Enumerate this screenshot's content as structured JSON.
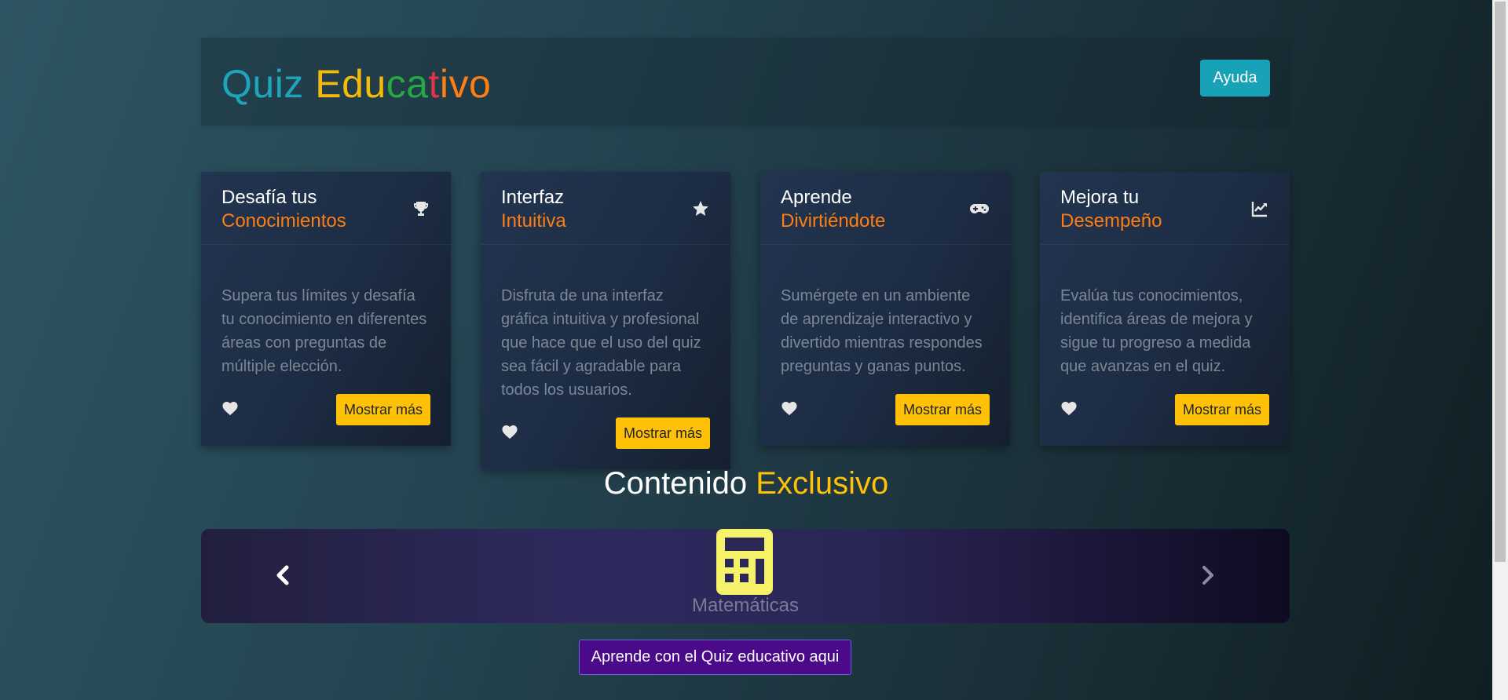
{
  "header": {
    "title_parts": [
      "Quiz",
      "Edu",
      "ca",
      "t",
      "ivo"
    ],
    "help_label": "Ayuda"
  },
  "cards": [
    {
      "title_line1": "Desafía tus",
      "title_line2": "Conocimientos",
      "icon": "trophy-icon",
      "text": "Supera tus límites y desafía tu conocimiento en diferentes áreas con preguntas de múltiple elección.",
      "button": "Mostrar más"
    },
    {
      "title_line1": "Interfaz",
      "title_line2": "Intuitiva",
      "icon": "star-icon",
      "text": "Disfruta de una interfaz gráfica intuitiva y profesional que hace que el uso del quiz sea fácil y agradable para todos los usuarios.",
      "button": "Mostrar más"
    },
    {
      "title_line1": "Aprende",
      "title_line2": "Divirtiéndote",
      "icon": "gamepad-icon",
      "text": "Sumérgete en un ambiente de aprendizaje interactivo y divertido mientras respondes preguntas y ganas puntos.",
      "button": "Mostrar más"
    },
    {
      "title_line1": "Mejora tu",
      "title_line2": "Desempeño",
      "icon": "chart-line-icon",
      "text": "Evalúa tus conocimientos, identifica áreas de mejora y sigue tu progreso a medida que avanzas en el quiz.",
      "button": "Mostrar más"
    }
  ],
  "section": {
    "title_part1": "Contenido",
    "title_part2": "Exclusivo"
  },
  "carousel": {
    "label": "Matemáticas",
    "icon": "calculator-icon"
  },
  "cta": {
    "label": "Aprende con el Quiz educativo aqui"
  },
  "colors": {
    "accent_teal": "#17a2b8",
    "accent_yellow": "#ffc107",
    "accent_orange": "#fd7e14",
    "cta_purple": "#4b0a8a",
    "calculator_yellow": "#f6f26a"
  }
}
